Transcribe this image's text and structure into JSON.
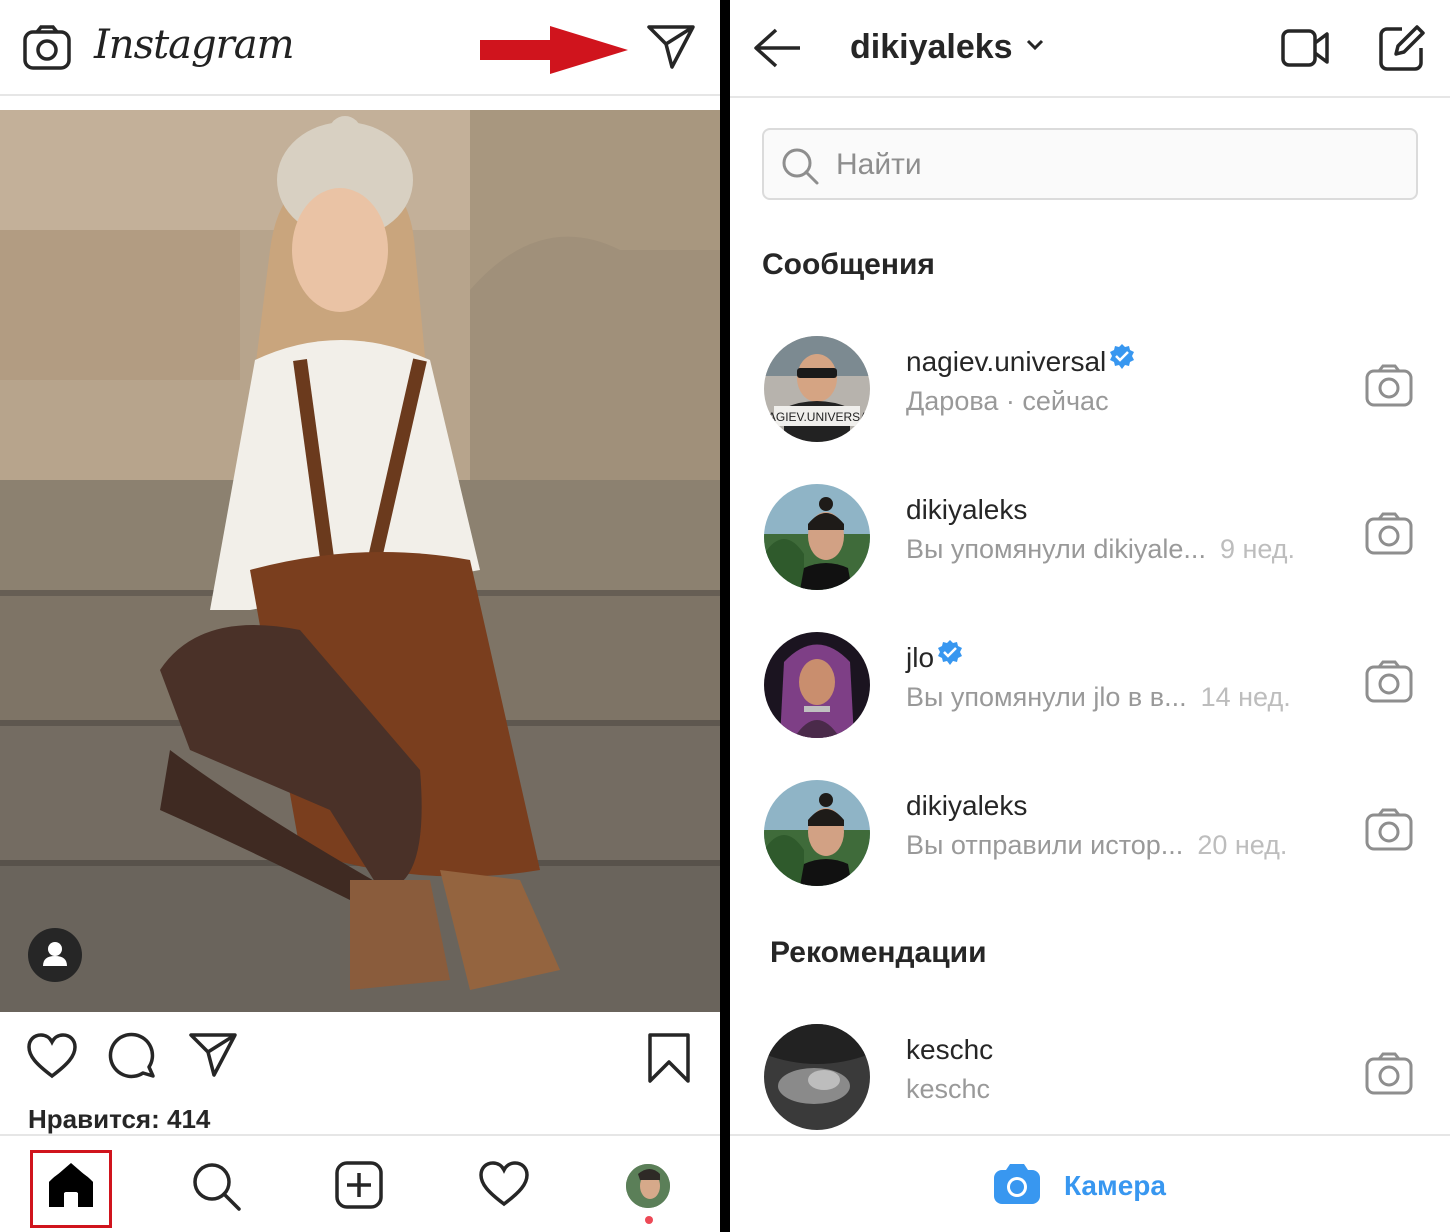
{
  "feed": {
    "logo": "Instagram",
    "likes_label": "Нравится: 414"
  },
  "direct": {
    "username": "dikiyaleks",
    "search_placeholder": "Найти",
    "messages_heading": "Сообщения",
    "threads": [
      {
        "name": "nagiev.universal",
        "verified": true,
        "preview": "Дарова · сейчас",
        "time": ""
      },
      {
        "name": "dikiyaleks",
        "verified": false,
        "preview": "Вы упомянули dikiyale...",
        "time": "9 нед."
      },
      {
        "name": "jlo",
        "verified": true,
        "preview": "Вы упомянули jlo в в...",
        "time": "14 нед."
      },
      {
        "name": "dikiyaleks",
        "verified": false,
        "preview": "Вы отправили истор...",
        "time": "20 нед."
      }
    ],
    "recommendations_heading": "Рекомендации",
    "recommendations": [
      {
        "name": "keschc",
        "subtitle": "keschc"
      }
    ],
    "camera_label": "Камера"
  },
  "colors": {
    "accent_blue": "#3897f0",
    "highlight_red": "#d0141d",
    "verified_blue": "#3897f0"
  },
  "icons": [
    "camera-icon",
    "direct-send-icon",
    "red-arrow",
    "heart-icon",
    "comment-icon",
    "share-icon",
    "bookmark-icon",
    "home-icon",
    "search-icon",
    "add-post-icon",
    "activity-icon",
    "back-arrow-icon",
    "video-call-icon",
    "new-message-icon",
    "verified-badge-icon"
  ]
}
